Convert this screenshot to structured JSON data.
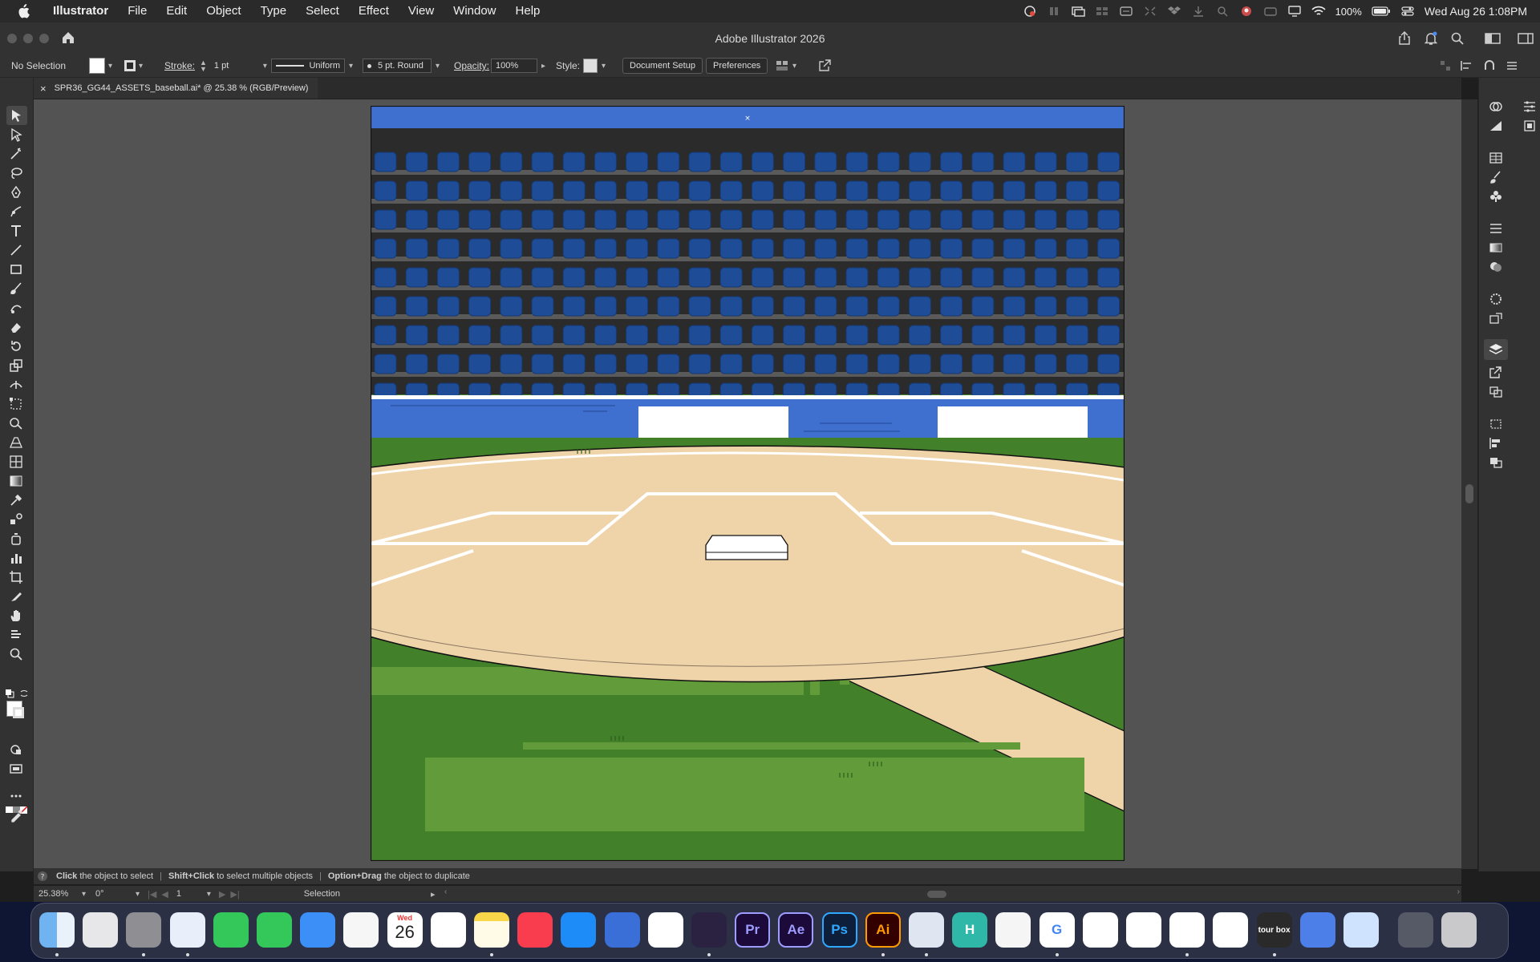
{
  "menubar": {
    "app_name": "Illustrator",
    "items": [
      "File",
      "Edit",
      "Object",
      "Type",
      "Select",
      "Effect",
      "View",
      "Window",
      "Help"
    ],
    "battery": "100%",
    "datetime": "Wed Aug 26  1:08PM"
  },
  "window": {
    "title": "Adobe Illustrator 2026"
  },
  "controlbar": {
    "selection_state": "No Selection",
    "stroke_label": "Stroke:",
    "stroke_value": "1 pt",
    "stroke_profile": "Uniform",
    "brush": "5 pt. Round",
    "opacity_label": "Opacity:",
    "opacity_value": "100%",
    "style_label": "Style:",
    "document_setup": "Document Setup",
    "preferences": "Preferences"
  },
  "document_tab": {
    "close": "×",
    "title": "SPR36_GG44_ASSETS_baseball.ai* @ 25.38 % (RGB/Preview)"
  },
  "hint": {
    "part1_bold": "Click",
    "part1": "the object to select",
    "part2_bold": "Shift+Click",
    "part2": "to select multiple objects",
    "part3_bold": "Option+Drag",
    "part3": "the object to duplicate"
  },
  "statusbar": {
    "zoom": "25.38%",
    "rotation": "0°",
    "artboard_number": "1",
    "tool_name": "Selection"
  },
  "calendar_icon": {
    "month": "Wed",
    "day": "26"
  },
  "colors": {
    "canvas": "#535353",
    "stadium_blue": "#3f6fcf",
    "seat_blue": "#1f4c96",
    "dirt": "#efd3a9",
    "grass_dark": "#43802a",
    "grass_light": "#629b3a"
  },
  "dock_apps": [
    {
      "name": "Finder"
    },
    {
      "name": "Launchpad"
    },
    {
      "name": "System Settings"
    },
    {
      "name": "Safari"
    },
    {
      "name": "Messages"
    },
    {
      "name": "FaceTime"
    },
    {
      "name": "Mail"
    },
    {
      "name": "Photos"
    },
    {
      "name": "Calendar"
    },
    {
      "name": "Reminders"
    },
    {
      "name": "Notes"
    },
    {
      "name": "Music"
    },
    {
      "name": "App Store"
    },
    {
      "name": "Tasks"
    },
    {
      "name": "Notion"
    },
    {
      "name": "Activity"
    },
    {
      "name": "Premiere Pro",
      "label": "Pr"
    },
    {
      "name": "After Effects",
      "label": "Ae"
    },
    {
      "name": "Photoshop",
      "label": "Ps"
    },
    {
      "name": "Illustrator",
      "label": "Ai"
    },
    {
      "name": "Preview"
    },
    {
      "name": "H App",
      "label": "H"
    },
    {
      "name": "Music Player"
    },
    {
      "name": "Google",
      "label": "G"
    },
    {
      "name": "Freeform"
    },
    {
      "name": "YouTube"
    },
    {
      "name": "Perplexity"
    },
    {
      "name": "Parallels"
    },
    {
      "name": "Tourbox",
      "label": "tour box"
    },
    {
      "name": "iPhone Mirroring"
    },
    {
      "name": "Waves"
    },
    {
      "name": "Downloads"
    },
    {
      "name": "Trash"
    }
  ]
}
